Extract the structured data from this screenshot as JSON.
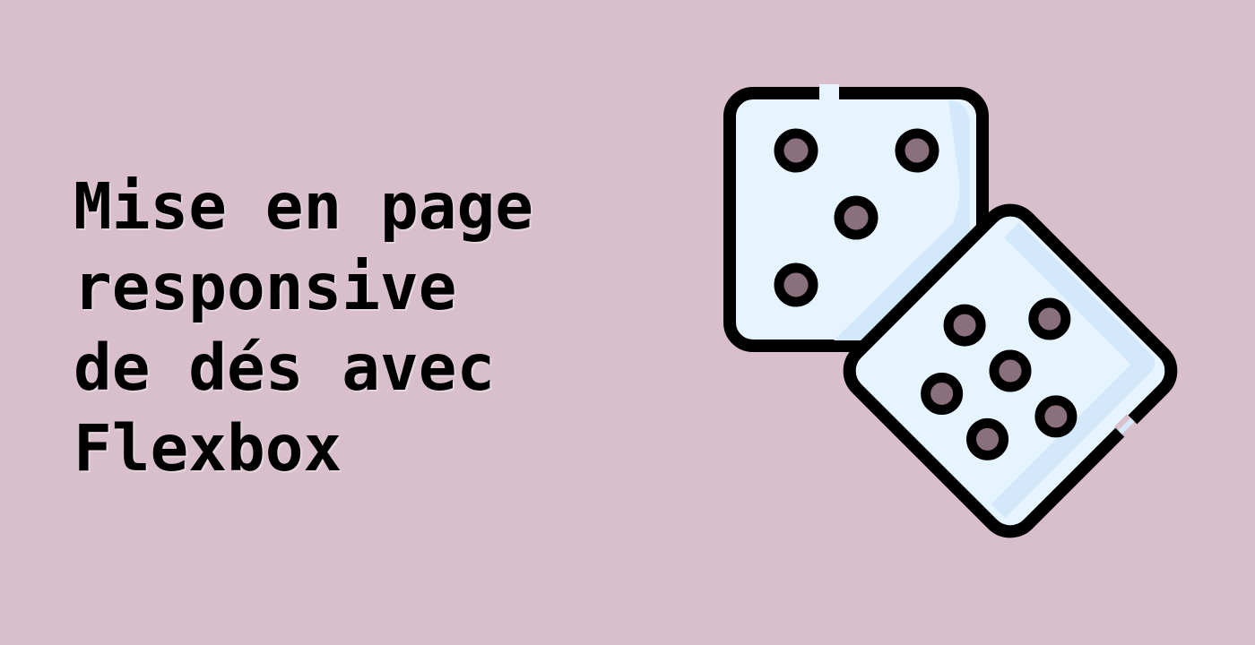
{
  "page": {
    "background_color": "#d8bfcb"
  },
  "headline": {
    "lines": [
      "Mise en page",
      "responsive",
      "de dés avec",
      "Flexbox"
    ]
  },
  "illustration": {
    "icon": "dice-icon",
    "colors": {
      "outline": "#000000",
      "face": "#e6f4ff",
      "face_shade": "#d3e8fb",
      "pip_center": "#8a707c"
    }
  }
}
